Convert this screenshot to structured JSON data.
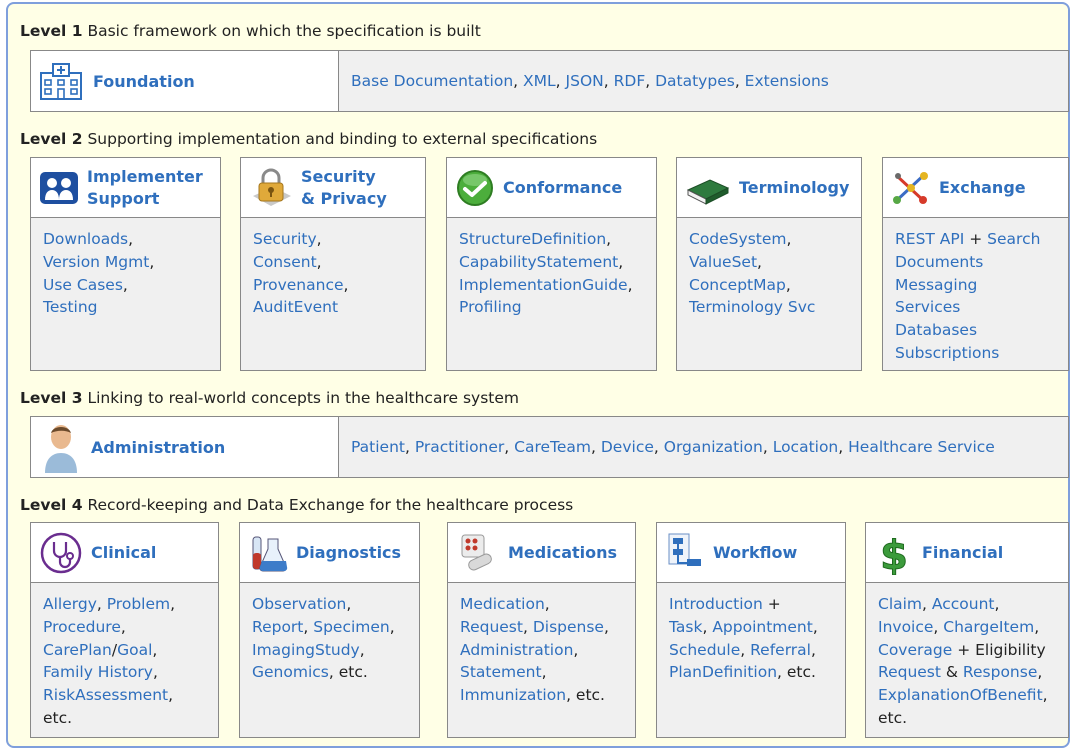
{
  "levels": [
    {
      "num": "Level 1",
      "desc": "Basic framework on which the specification is built"
    },
    {
      "num": "Level 2",
      "desc": "Supporting implementation and binding to external specifications"
    },
    {
      "num": "Level 3",
      "desc": "Linking to real-world concepts in the healthcare system"
    },
    {
      "num": "Level 4",
      "desc": "Record-keeping and Data Exchange for the healthcare process"
    }
  ],
  "foundation": {
    "title": "Foundation",
    "links": [
      "Base Documentation",
      "XML",
      "JSON",
      "RDF",
      "Datatypes",
      "Extensions"
    ]
  },
  "administration": {
    "title": "Administration",
    "links": [
      "Patient",
      "Practitioner",
      "CareTeam",
      "Device",
      "Organization",
      "Location",
      "Healthcare Service"
    ]
  },
  "level2": [
    {
      "title_l1": "Implementer",
      "title_l2": "Support",
      "icon": "implementer-icon",
      "lines": [
        [
          [
            "Downloads",
            "l"
          ],
          [
            ",",
            "t"
          ]
        ],
        [
          [
            "Version Mgmt",
            "l"
          ],
          [
            ",",
            "t"
          ]
        ],
        [
          [
            "Use Cases",
            "l"
          ],
          [
            ",",
            "t"
          ]
        ],
        [
          [
            "Testing",
            "l"
          ]
        ]
      ]
    },
    {
      "title_l1": "Security",
      "title_l2": "& Privacy",
      "icon": "padlock-icon",
      "lines": [
        [
          [
            "Security",
            "l"
          ],
          [
            ",",
            "t"
          ]
        ],
        [
          [
            "Consent",
            "l"
          ],
          [
            ",",
            "t"
          ]
        ],
        [
          [
            "Provenance",
            "l"
          ],
          [
            ",",
            "t"
          ]
        ],
        [
          [
            "AuditEvent",
            "l"
          ]
        ]
      ]
    },
    {
      "title_l1": "Conformance",
      "title_l2": "",
      "icon": "checkmark-icon",
      "lines": [
        [
          [
            "StructureDefinition",
            "l"
          ],
          [
            ",",
            "t"
          ]
        ],
        [
          [
            "CapabilityStatement",
            "l"
          ],
          [
            ",",
            "t"
          ]
        ],
        [
          [
            "ImplementationGuide",
            "l"
          ],
          [
            ",",
            "t"
          ]
        ],
        [
          [
            "Profiling",
            "l"
          ]
        ]
      ]
    },
    {
      "title_l1": "Terminology",
      "title_l2": "",
      "icon": "book-icon",
      "lines": [
        [
          [
            "CodeSystem",
            "l"
          ],
          [
            ",",
            "t"
          ]
        ],
        [
          [
            "ValueSet",
            "l"
          ],
          [
            ",",
            "t"
          ]
        ],
        [
          [
            "ConceptMap",
            "l"
          ],
          [
            ",",
            "t"
          ]
        ],
        [
          [
            "Terminology Svc",
            "l"
          ]
        ]
      ]
    },
    {
      "title_l1": "Exchange",
      "title_l2": "",
      "icon": "exchange-icon",
      "lines": [
        [
          [
            "REST API",
            "l"
          ],
          [
            " + ",
            "t"
          ],
          [
            "Search",
            "l"
          ]
        ],
        [
          [
            "Documents",
            "l"
          ]
        ],
        [
          [
            "Messaging",
            "l"
          ]
        ],
        [
          [
            "Services",
            "l"
          ]
        ],
        [
          [
            "Databases",
            "l"
          ]
        ],
        [
          [
            "Subscriptions",
            "l"
          ]
        ]
      ]
    }
  ],
  "level4": [
    {
      "title_l1": "Clinical",
      "icon": "stethoscope-icon",
      "lines": [
        [
          [
            "Allergy",
            "l"
          ],
          [
            ", ",
            "t"
          ],
          [
            "Problem",
            "l"
          ],
          [
            ",",
            "t"
          ]
        ],
        [
          [
            "Procedure",
            "l"
          ],
          [
            ",",
            "t"
          ]
        ],
        [
          [
            "CarePlan",
            "l"
          ],
          [
            "/",
            "t"
          ],
          [
            "Goal",
            "l"
          ],
          [
            ",",
            "t"
          ]
        ],
        [
          [
            "Family History",
            "l"
          ],
          [
            ",",
            "t"
          ]
        ],
        [
          [
            "RiskAssessment",
            "l"
          ],
          [
            ",",
            "t"
          ]
        ],
        [
          [
            "etc.",
            "t"
          ]
        ]
      ]
    },
    {
      "title_l1": "Diagnostics",
      "icon": "lab-flask-icon",
      "lines": [
        [
          [
            "Observation",
            "l"
          ],
          [
            ",",
            "t"
          ]
        ],
        [
          [
            "Report",
            "l"
          ],
          [
            ", ",
            "t"
          ],
          [
            "Specimen",
            "l"
          ],
          [
            ",",
            "t"
          ]
        ],
        [
          [
            "ImagingStudy",
            "l"
          ],
          [
            ",",
            "t"
          ]
        ],
        [
          [
            "Genomics",
            "l"
          ],
          [
            ", etc.",
            "t"
          ]
        ]
      ]
    },
    {
      "title_l1": "Medications",
      "icon": "pills-icon",
      "lines": [
        [
          [
            "Medication",
            "l"
          ],
          [
            ",",
            "t"
          ]
        ],
        [
          [
            "Request",
            "l"
          ],
          [
            ", ",
            "t"
          ],
          [
            "Dispense",
            "l"
          ],
          [
            ",",
            "t"
          ]
        ],
        [
          [
            "Administration",
            "l"
          ],
          [
            ",",
            "t"
          ]
        ],
        [
          [
            "Statement",
            "l"
          ],
          [
            ",",
            "t"
          ]
        ],
        [
          [
            "Immunization",
            "l"
          ],
          [
            ", etc.",
            "t"
          ]
        ]
      ]
    },
    {
      "title_l1": "Workflow",
      "icon": "workflow-icon",
      "lines": [
        [
          [
            "Introduction",
            "l"
          ],
          [
            " +",
            "t"
          ]
        ],
        [
          [
            "Task",
            "l"
          ],
          [
            ", ",
            "t"
          ],
          [
            "Appointment",
            "l"
          ],
          [
            ",",
            "t"
          ]
        ],
        [
          [
            "Schedule",
            "l"
          ],
          [
            ", ",
            "t"
          ],
          [
            "Referral",
            "l"
          ],
          [
            ",",
            "t"
          ]
        ],
        [
          [
            "PlanDefinition",
            "l"
          ],
          [
            ", etc.",
            "t"
          ]
        ]
      ]
    },
    {
      "title_l1": "Financial",
      "icon": "dollar-icon",
      "lines": [
        [
          [
            "Claim",
            "l"
          ],
          [
            ", ",
            "t"
          ],
          [
            "Account",
            "l"
          ],
          [
            ",",
            "t"
          ]
        ],
        [
          [
            "Invoice",
            "l"
          ],
          [
            ", ",
            "t"
          ],
          [
            "ChargeItem",
            "l"
          ],
          [
            ",",
            "t"
          ]
        ],
        [
          [
            "Coverage",
            "l"
          ],
          [
            " + Eligibility",
            "t"
          ]
        ],
        [
          [
            "Request",
            "l"
          ],
          [
            " & ",
            "t"
          ],
          [
            "Response",
            "l"
          ],
          [
            ",",
            "t"
          ]
        ],
        [
          [
            "ExplanationOfBenefit",
            "l"
          ],
          [
            ",",
            "t"
          ]
        ],
        [
          [
            "etc.",
            "t"
          ]
        ]
      ]
    }
  ]
}
